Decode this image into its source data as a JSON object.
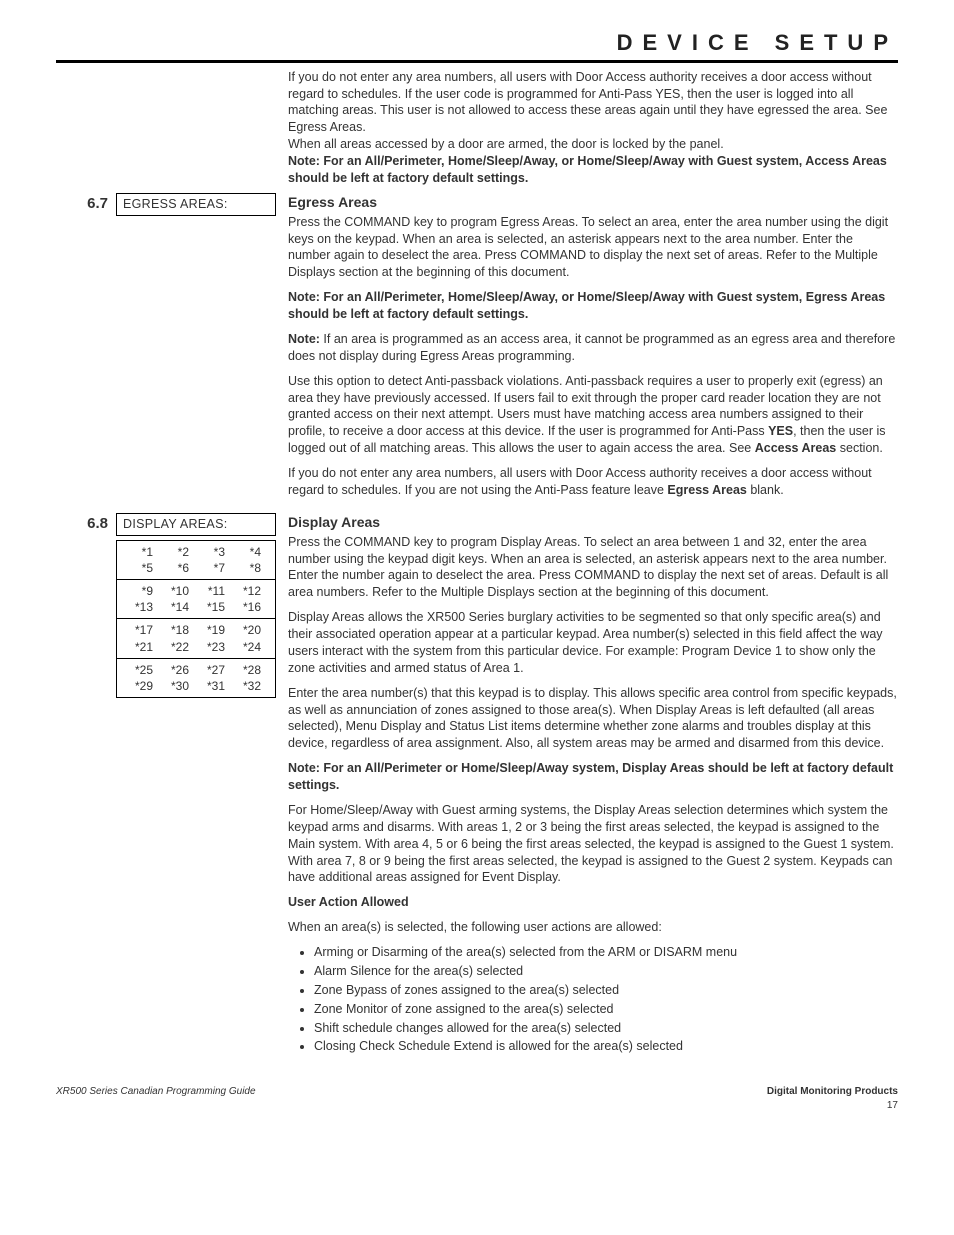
{
  "header": {
    "title": "DEVICE SETUP"
  },
  "intro": {
    "p1": "If you do not enter any area numbers, all users with Door Access authority receives a door access without regard to schedules.  If the user code is programmed for Anti-Pass YES, then the user is logged into all matching areas.  This user is not allowed to access these areas again until they have egressed the area.  See Egress Areas.",
    "p2": "When all areas accessed by a door are armed, the door is locked by the panel.",
    "note": "Note: For an All/Perimeter, Home/Sleep/Away, or Home/Sleep/Away with Guest system, Access Areas should be left at factory default settings."
  },
  "s67": {
    "num": "6.7",
    "box": "EGRESS AREAS:",
    "title": "Egress Areas",
    "p1": "Press the COMMAND key to program Egress Areas.  To select an area, enter the area number using the digit keys on the keypad.  When an area is selected, an asterisk appears next to the area number.  Enter the number again to deselect the area.  Press COMMAND to display the next set of areas.  Refer to the Multiple Displays section at the beginning of this document.",
    "note1": "Note: For an All/Perimeter, Home/Sleep/Away, or Home/Sleep/Away with Guest system, Egress Areas should be left at factory default settings.",
    "note2_prefix": "Note:",
    "note2_body": " If an area is programmed as an access area, it cannot be programmed as an egress area and therefore does not display during Egress Areas programming.",
    "p2a": "Use this option to detect Anti-passback violations.  Anti-passback requires a user to properly exit (egress) an area they have previously accessed.  If users fail to exit through the proper card reader location they are not granted access on their next attempt.  Users must have matching access area numbers assigned to their profile, to receive a door access at this device.  If the user is programmed for Anti-Pass ",
    "p2_yes": "YES",
    "p2b": ", then the user is logged out of all matching areas.  This allows the user to again access the area.  See ",
    "p2_link": "Access Areas",
    "p2c": " section.",
    "p3a": "If you do not enter any area numbers, all users with Door Access authority receives a door access without regard to schedules.  If you are not using the Anti-Pass feature leave ",
    "p3_bold": "Egress Areas",
    "p3b": " blank."
  },
  "s68": {
    "num": "6.8",
    "box": "DISPLAY AREAS:",
    "title": "Display Areas",
    "table": [
      [
        [
          "*1",
          "*2",
          "*3",
          "*4"
        ],
        [
          "*5",
          "*6",
          "*7",
          "*8"
        ]
      ],
      [
        [
          "*9",
          "*10",
          "*11",
          "*12"
        ],
        [
          "*13",
          "*14",
          "*15",
          "*16"
        ]
      ],
      [
        [
          "*17",
          "*18",
          "*19",
          "*20"
        ],
        [
          "*21",
          "*22",
          "*23",
          "*24"
        ]
      ],
      [
        [
          "*25",
          "*26",
          "*27",
          "*28"
        ],
        [
          "*29",
          "*30",
          "*31",
          "*32"
        ]
      ]
    ],
    "p1": "Press the COMMAND key to program Display Areas.  To select an area between 1 and 32, enter the area number using the keypad digit keys.  When an area is selected, an asterisk appears next to the area number.  Enter the number again to deselect the area.  Press COMMAND to display the next set of areas.  Default is all area numbers.  Refer to the Multiple Displays section at the beginning of this document.",
    "p2": "Display Areas allows the XR500 Series burglary activities to be segmented so that only specific area(s) and their associated operation appear at a particular keypad.  Area number(s) selected in this field affect the way users interact with the system from this particular device.  For example: Program Device 1 to show only the zone activities and armed status of Area 1.",
    "p3": "Enter the area number(s) that this keypad is to display.  This allows specific area control from specific keypads, as well as annunciation of zones assigned to those area(s).  When Display Areas is left defaulted (all areas selected), Menu Display and Status List items determine whether zone alarms and troubles display at this device, regardless of area assignment.  Also, all system areas may be armed and disarmed from this device.",
    "note": "Note: For an All/Perimeter or Home/Sleep/Away system, Display Areas should be left at factory default settings.",
    "p4": "For Home/Sleep/Away with Guest arming systems, the Display Areas selection determines which system the keypad arms and disarms.  With areas 1, 2 or 3 being the first areas selected, the keypad is assigned to the Main system. With area 4, 5 or 6 being the first areas selected, the keypad is assigned to the Guest 1 system. With area 7, 8 or 9 being the first areas selected, the keypad is assigned to the Guest 2 system. Keypads can have additional areas assigned for Event Display.",
    "sub": "User Action Allowed",
    "p5": "When an area(s) is selected, the following user actions are allowed:",
    "bullets": [
      "Arming or Disarming of the area(s) selected from the ARM or DISARM menu",
      "Alarm Silence for the area(s) selected",
      "Zone Bypass of zones assigned to the area(s) selected",
      "Zone Monitor of zone assigned to the area(s) selected",
      "Shift schedule changes allowed for the area(s) selected",
      "Closing Check Schedule Extend is allowed for the area(s) selected"
    ]
  },
  "footer": {
    "left": "XR500 Series Canadian Programming Guide",
    "right_brand": "Digital Monitoring Products",
    "right_page": "17"
  }
}
